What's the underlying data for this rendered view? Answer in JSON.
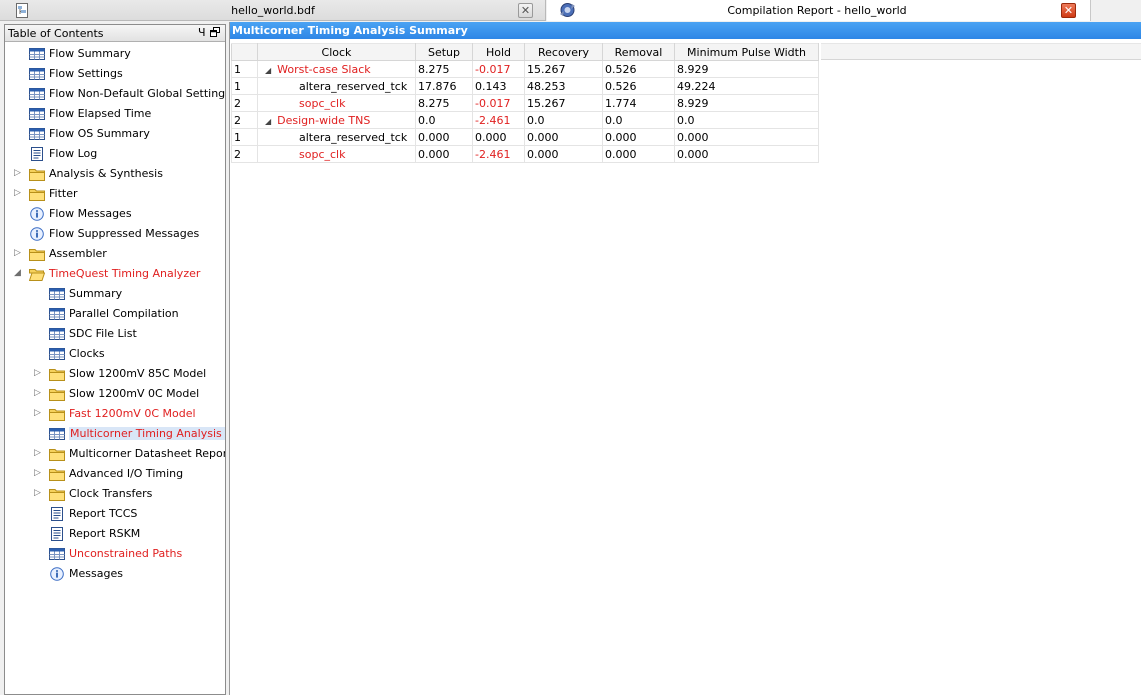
{
  "tabs": [
    {
      "title": "hello_world.bdf",
      "icon": "document-icon"
    },
    {
      "title": "Compilation Report - hello_world",
      "icon": "compile-report-icon"
    }
  ],
  "toc": {
    "title": "Table of Contents",
    "pin_glyph": "Ч",
    "items": [
      {
        "label": "Flow Summary",
        "icon": "table-icon"
      },
      {
        "label": "Flow Settings",
        "icon": "table-icon"
      },
      {
        "label": "Flow Non-Default Global Settings",
        "icon": "table-icon"
      },
      {
        "label": "Flow Elapsed Time",
        "icon": "table-icon"
      },
      {
        "label": "Flow OS Summary",
        "icon": "table-icon"
      },
      {
        "label": "Flow Log",
        "icon": "text-file-icon"
      },
      {
        "label": "Analysis & Synthesis",
        "icon": "folder-icon"
      },
      {
        "label": "Fitter",
        "icon": "folder-icon"
      },
      {
        "label": "Flow Messages",
        "icon": "info-icon"
      },
      {
        "label": "Flow Suppressed Messages",
        "icon": "info-icon"
      },
      {
        "label": "Assembler",
        "icon": "folder-icon"
      },
      {
        "label": "TimeQuest Timing Analyzer",
        "icon": "folder-open-icon"
      },
      {
        "label": "Summary",
        "icon": "table-icon"
      },
      {
        "label": "Parallel Compilation",
        "icon": "table-icon"
      },
      {
        "label": "SDC File List",
        "icon": "table-icon"
      },
      {
        "label": "Clocks",
        "icon": "table-icon"
      },
      {
        "label": "Slow 1200mV 85C Model",
        "icon": "folder-icon"
      },
      {
        "label": "Slow 1200mV 0C Model",
        "icon": "folder-icon"
      },
      {
        "label": "Fast 1200mV 0C Model",
        "icon": "folder-icon"
      },
      {
        "label": "Multicorner Timing Analysis Summr",
        "icon": "table-icon"
      },
      {
        "label": "Multicorner Datasheet Report Su",
        "icon": "folder-icon"
      },
      {
        "label": "Advanced I/O Timing",
        "icon": "folder-icon"
      },
      {
        "label": "Clock Transfers",
        "icon": "folder-icon"
      },
      {
        "label": "Report TCCS",
        "icon": "text-file-icon"
      },
      {
        "label": "Report RSKM",
        "icon": "text-file-icon"
      },
      {
        "label": "Unconstrained Paths",
        "icon": "table-icon"
      },
      {
        "label": "Messages",
        "icon": "info-icon"
      }
    ]
  },
  "report": {
    "title": "Multicorner Timing Analysis Summary",
    "columns": [
      "Clock",
      "Setup",
      "Hold",
      "Recovery",
      "Removal",
      "Minimum Pulse Width"
    ],
    "rows": [
      {
        "num": "1",
        "clock": "Worst-case Slack",
        "setup": "8.275",
        "hold": "-0.017",
        "recovery": "15.267",
        "removal": "0.526",
        "mpw": "8.929"
      },
      {
        "num": "1",
        "clock": "altera_reserved_tck",
        "setup": "17.876",
        "hold": "0.143",
        "recovery": "48.253",
        "removal": "0.526",
        "mpw": "49.224"
      },
      {
        "num": "2",
        "clock": "sopc_clk",
        "setup": "8.275",
        "hold": "-0.017",
        "recovery": "15.267",
        "removal": "1.774",
        "mpw": "8.929"
      },
      {
        "num": "2",
        "clock": "Design-wide TNS",
        "setup": "0.0",
        "hold": "-2.461",
        "recovery": "0.0",
        "removal": "0.0",
        "mpw": "0.0"
      },
      {
        "num": "1",
        "clock": "altera_reserved_tck",
        "setup": "0.000",
        "hold": "0.000",
        "recovery": "0.000",
        "removal": "0.000",
        "mpw": "0.000"
      },
      {
        "num": "2",
        "clock": "sopc_clk",
        "setup": "0.000",
        "hold": "-2.461",
        "recovery": "0.000",
        "removal": "0.000",
        "mpw": "0.000"
      }
    ]
  },
  "colors": {
    "highlight_red": "#e02020",
    "title_bar_blue": "#3a93ec",
    "selection": "#d9e6f7"
  }
}
